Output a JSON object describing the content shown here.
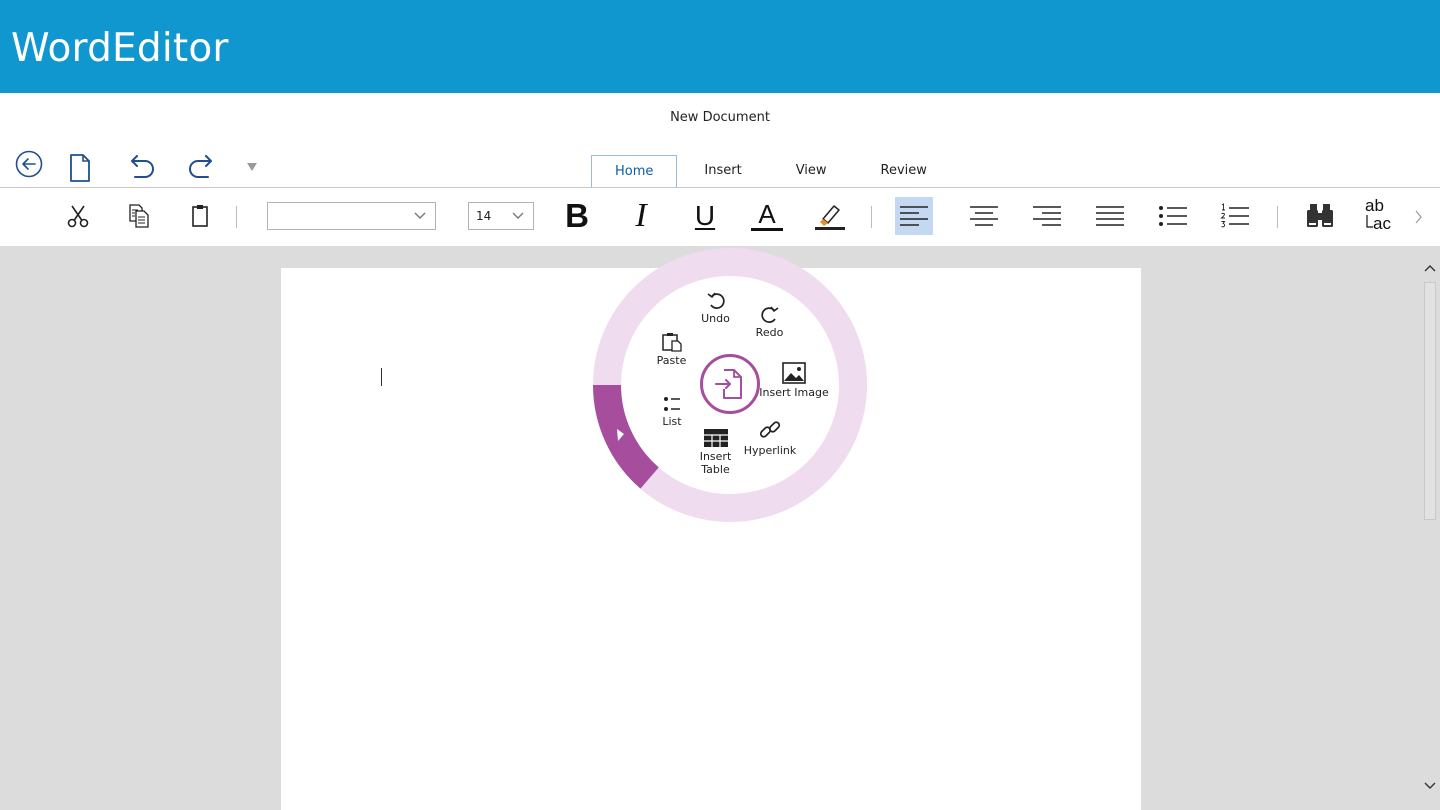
{
  "app": {
    "title": "WordEditor",
    "accent": "#1197cf"
  },
  "document": {
    "title": "New Document"
  },
  "quick_access": [
    {
      "name": "back",
      "icon": "back-arrow-icon"
    },
    {
      "name": "new",
      "icon": "new-document-icon"
    },
    {
      "name": "undo",
      "icon": "undo-icon"
    },
    {
      "name": "redo",
      "icon": "redo-icon"
    },
    {
      "name": "customize",
      "icon": "dropdown-triangle-icon"
    }
  ],
  "tabs": [
    {
      "label": "Home",
      "active": true
    },
    {
      "label": "Insert",
      "active": false
    },
    {
      "label": "View",
      "active": false
    },
    {
      "label": "Review",
      "active": false
    }
  ],
  "ribbon": {
    "font_family_value": "",
    "font_size_value": "14",
    "bold_label": "B",
    "italic_label": "I",
    "underline_label": "U",
    "font_color_label": "A",
    "replace_top": "ab",
    "replace_bottom": "ac",
    "selected_alignment": "align-left"
  },
  "radial_menu": {
    "ring_color": "#efdcee",
    "accent": "#a64d9d",
    "items": {
      "undo": "Undo",
      "redo": "Redo",
      "paste": "Paste",
      "insert_image": "Insert Image",
      "list": "List",
      "hyperlink": "Hyperlink",
      "insert_table_line1": "Insert",
      "insert_table_line2": "Table"
    }
  }
}
